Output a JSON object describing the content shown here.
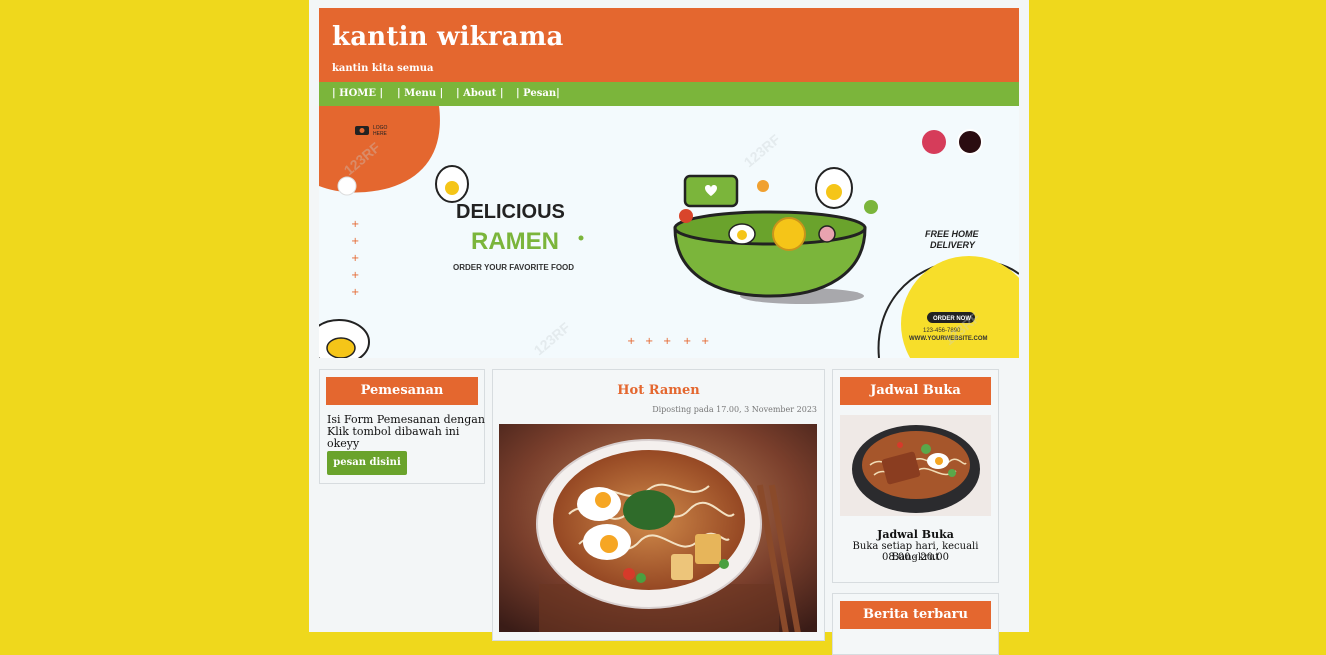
{
  "header": {
    "title": "kantin wikrama",
    "tagline": "kantin kita semua"
  },
  "nav": {
    "items": [
      "| HOME |",
      "| Menu |",
      "| About |",
      "| Pesan|"
    ]
  },
  "banner": {
    "logo_line1": "LOGO",
    "logo_line2": "HERE",
    "headline": "DELICIOUS",
    "product": "RAMEN",
    "sub": "ORDER YOUR FAVORITE FOOD",
    "delivery_line1": "FREE HOME",
    "delivery_line2": "DELIVERY",
    "order_button": "ORDER NOW",
    "phone": "123-456-7890",
    "website": "WWW.YOURWEBSITE.COM",
    "watermark": "123RF"
  },
  "left": {
    "heading": "Pemesanan",
    "text": "Isi Form Pemesanan dengan Klik tombol dibawah ini okeyy",
    "button": "pesan disini"
  },
  "post": {
    "title": "Hot Ramen",
    "meta": "Diposting pada 17.00, 3 November 2023"
  },
  "schedule": {
    "heading": "Jadwal Buka",
    "title": "Jadwal Buka",
    "line1": "Buka setiap hari, kecuali Bangkrut",
    "line2": "08.00 - 20.00"
  },
  "news": {
    "heading": "Berita terbaru"
  },
  "colors": {
    "background": "#efd81c",
    "accent_orange": "#e4672f",
    "nav_green": "#7bb53b",
    "button_green": "#6aa32c"
  }
}
